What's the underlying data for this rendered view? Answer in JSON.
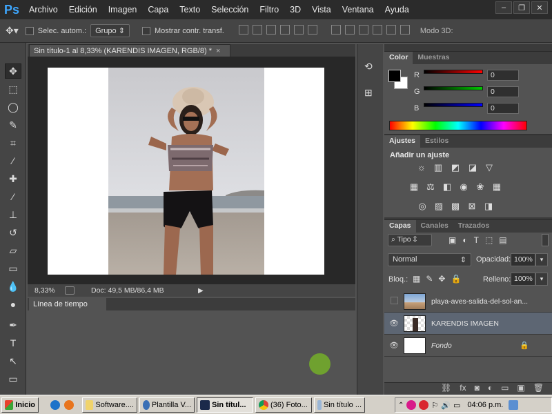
{
  "menubar": {
    "logo": "Ps",
    "items": [
      "Archivo",
      "Edición",
      "Imagen",
      "Capa",
      "Texto",
      "Selección",
      "Filtro",
      "3D",
      "Vista",
      "Ventana",
      "Ayuda"
    ],
    "window_controls": [
      "–",
      "❐",
      "✕"
    ]
  },
  "options": {
    "auto_select_label": "Selec. autom.:",
    "group_value": "Grupo",
    "show_transform_label": "Mostrar contr. transf.",
    "mode_label": "Modo 3D:"
  },
  "document": {
    "tab_title": "Sin título-1 al 8,33% (KARENDIS IMAGEN, RGB/8) *",
    "close": "×",
    "zoom": "8,33%",
    "doc_info": "Doc: 49,5 MB/86,4 MB"
  },
  "timeline": {
    "title": "Línea de tiempo"
  },
  "color_panel": {
    "tabs": [
      "Color",
      "Muestras"
    ],
    "channels": [
      {
        "label": "R",
        "value": "0",
        "gradient_color": "#ff0000"
      },
      {
        "label": "G",
        "value": "0",
        "gradient_color": "#00c800"
      },
      {
        "label": "B",
        "value": "0",
        "gradient_color": "#0000ff"
      }
    ]
  },
  "adjustments_panel": {
    "tabs": [
      "Ajustes",
      "Estilos"
    ],
    "heading": "Añadir un ajuste"
  },
  "layers_panel": {
    "tabs": [
      "Capas",
      "Canales",
      "Trazados"
    ],
    "filter_value": "Tipo",
    "blend_mode": "Normal",
    "opacity_label": "Opacidad:",
    "opacity_value": "100%",
    "lock_label": "Bloq.:",
    "fill_label": "Relleno:",
    "fill_value": "100%",
    "layers": [
      {
        "name": "playa-aves-salida-del-sol-an...",
        "visible": false,
        "selected": false
      },
      {
        "name": "KARENDIS IMAGEN",
        "visible": true,
        "selected": true
      },
      {
        "name": "Fondo",
        "visible": true,
        "selected": false,
        "locked": true
      }
    ]
  },
  "taskbar": {
    "start_label": "Inicio",
    "buttons": [
      "Software....",
      "Plantilla V...",
      "Sin títul...",
      "(36) Foto...",
      "Sin título ..."
    ],
    "clock": "04:06 p.m."
  }
}
